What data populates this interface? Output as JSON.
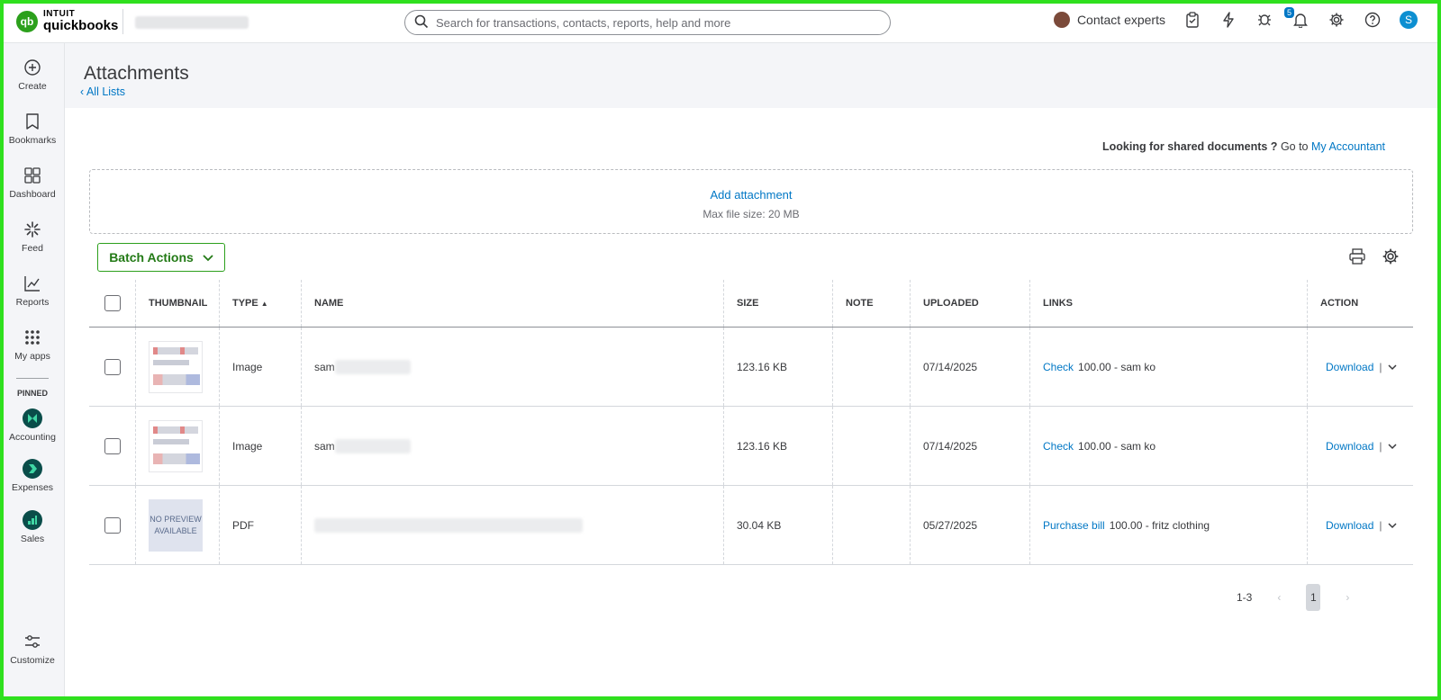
{
  "brand": {
    "line1": "INTUIT",
    "line2": "quickbooks",
    "badge": "qb"
  },
  "search": {
    "placeholder": "Search for transactions, contacts, reports, help and more"
  },
  "topbar": {
    "contact_label": "Contact experts",
    "notification_count": "5",
    "user_initial": "S"
  },
  "nav": {
    "items": [
      {
        "label": "Create",
        "icon": "plus-circle-icon"
      },
      {
        "label": "Bookmarks",
        "icon": "bookmark-icon"
      },
      {
        "label": "Dashboard",
        "icon": "grid-icon"
      },
      {
        "label": "Feed",
        "icon": "sparkle-icon"
      },
      {
        "label": "Reports",
        "icon": "chart-icon"
      },
      {
        "label": "My apps",
        "icon": "apps-icon"
      }
    ],
    "pinned_label": "PINNED",
    "pinned": [
      {
        "label": "Accounting"
      },
      {
        "label": "Expenses"
      },
      {
        "label": "Sales"
      }
    ],
    "customize_label": "Customize"
  },
  "page": {
    "title": "Attachments",
    "back_link": "All Lists",
    "shared_bold": "Looking for shared documents ?",
    "shared_goto": "Go to",
    "shared_link": "My Accountant",
    "add_attachment": "Add attachment",
    "max_size": "Max file size: 20 MB",
    "batch_actions": "Batch Actions"
  },
  "table": {
    "headers": {
      "thumbnail": "THUMBNAIL",
      "type": "TYPE",
      "name": "NAME",
      "size": "SIZE",
      "note": "NOTE",
      "uploaded": "UPLOADED",
      "links": "LINKS",
      "action": "ACTION"
    },
    "rows": [
      {
        "type": "Image",
        "name": "sam",
        "size": "123.16 KB",
        "note": "",
        "uploaded": "07/14/2025",
        "link_label": "Check",
        "link_detail": "100.00 - sam ko",
        "action": "Download",
        "thumb_text": ""
      },
      {
        "type": "Image",
        "name": "sam",
        "size": "123.16 KB",
        "note": "",
        "uploaded": "07/14/2025",
        "link_label": "Check",
        "link_detail": "100.00 - sam ko",
        "action": "Download",
        "thumb_text": ""
      },
      {
        "type": "PDF",
        "name": "",
        "size": "30.04 KB",
        "note": "",
        "uploaded": "05/27/2025",
        "link_label": "Purchase bill",
        "link_detail": "100.00 - fritz clothing",
        "action": "Download",
        "thumb_text": "NO PREVIEW AVAILABLE"
      }
    ]
  },
  "pager": {
    "range": "1-3",
    "current": "1"
  },
  "colors": {
    "brand_green": "#2ca01c",
    "link_blue": "#0077c5",
    "frame_green": "#2fe01e"
  }
}
